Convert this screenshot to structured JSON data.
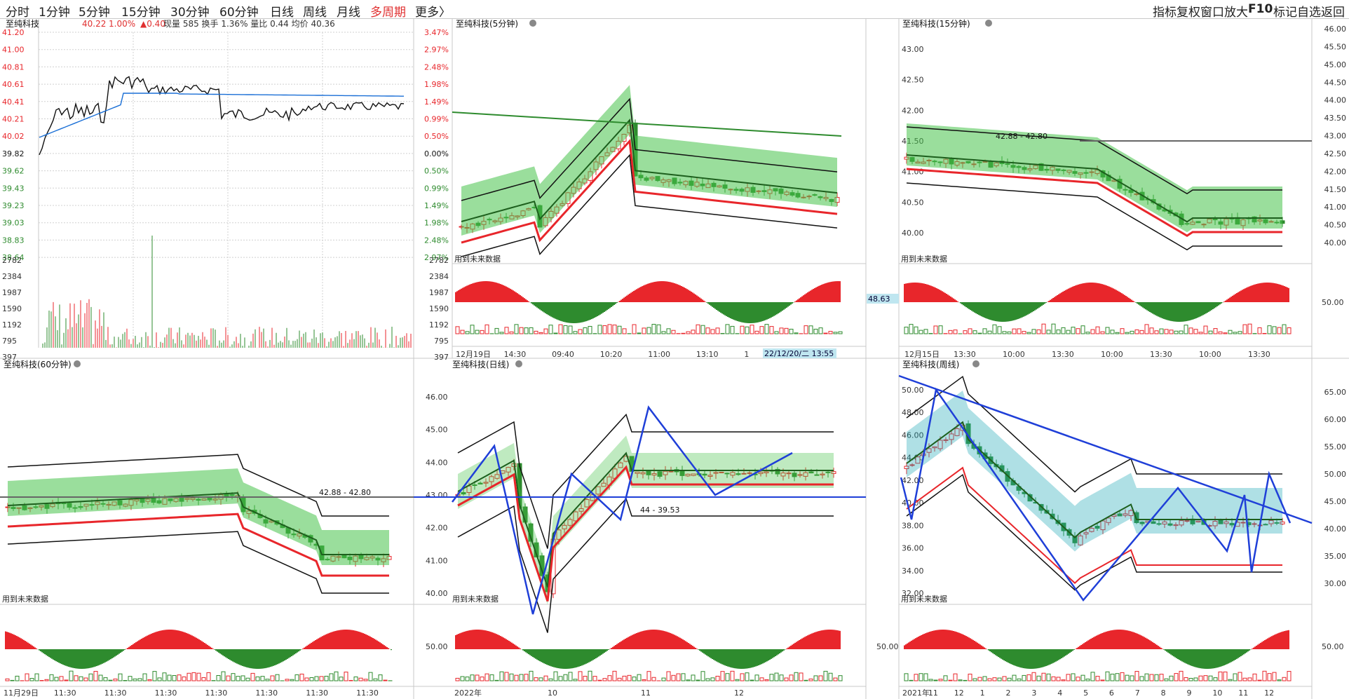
{
  "toolbar": {
    "tabs": [
      "分时",
      "1分钟",
      "5分钟",
      "15分钟",
      "30分钟",
      "60分钟",
      "日线",
      "周线",
      "月线",
      "多周期",
      "更多〉"
    ],
    "active_tab": "多周期",
    "tools": [
      "指标",
      "复权",
      "窗口",
      "放大",
      "F10",
      "标记",
      "自选",
      "返回"
    ]
  },
  "panels": {
    "intraday": {
      "title": "至纯科技",
      "price": "40.22",
      "pct": "1.00%",
      "change": "▲0.40",
      "info": "现量 585 换手 1.36% 量比 0.44 均价 40.36",
      "price_ticks": [
        "41.20",
        "41.00",
        "40.81",
        "40.61",
        "40.41",
        "40.21",
        "40.02",
        "39.82",
        "39.62",
        "39.43",
        "39.23",
        "39.03",
        "38.83",
        "38.64"
      ],
      "pct_ticks": [
        "3.47%",
        "2.97%",
        "2.48%",
        "1.98%",
        "1.49%",
        "0.99%",
        "0.50%",
        "0.00%",
        "0.50%",
        "0.99%",
        "1.49%",
        "1.98%",
        "2.48%",
        "2.97%"
      ],
      "vol_ticks": [
        "2782",
        "2384",
        "1987",
        "1590",
        "1192",
        "795",
        "397"
      ]
    },
    "p5m": {
      "title": "至纯科技(5分钟)",
      "future_label": "用到未来数据",
      "x_labels": [
        "12月19日",
        "14:30",
        "09:40",
        "10:20",
        "11:00",
        "13:10",
        "1"
      ],
      "cursor_time": "22/12/20/二 13:55"
    },
    "p15m": {
      "title": "至纯科技(15分钟)",
      "future_label": "用到未来数据",
      "left_ticks": [
        "43.00",
        "42.50",
        "42.00",
        "41.50",
        "41.00",
        "40.50",
        "40.00"
      ],
      "right_ticks": [
        "46.00",
        "45.50",
        "45.00",
        "44.50",
        "44.00",
        "43.50",
        "43.00",
        "42.50",
        "42.00",
        "41.50",
        "41.00",
        "40.50",
        "40.00"
      ],
      "hline_label": "42.88 - 42.80",
      "osc_value": "48.63",
      "osc_right_tick": "50.00",
      "x_labels": [
        "12月15日",
        "13:30",
        "10:00",
        "13:30",
        "10:00",
        "13:30",
        "10:00",
        "13:30"
      ]
    },
    "p60m": {
      "title": "至纯科技(60分钟)",
      "future_label": "用到未来数据",
      "hline_label": "42.88 - 42.80",
      "x_labels": [
        "11月29日",
        "11:30",
        "11:30",
        "11:30",
        "11:30",
        "11:30",
        "11:30",
        "11:30"
      ]
    },
    "pday": {
      "title": "至纯科技(日线)",
      "future_label": "用到未来数据",
      "left_ticks": [
        "46.00",
        "45.00",
        "44.00",
        "43.00",
        "42.00",
        "41.00",
        "40.00"
      ],
      "hline_label": "44 - 39.53",
      "osc_tick": "50.00",
      "x_labels": [
        "2022年",
        "10",
        "11",
        "12"
      ]
    },
    "pweek": {
      "title": "至纯科技(周线)",
      "future_label": "用到未来数据",
      "left_ticks": [
        "50.00",
        "48.00",
        "46.00",
        "44.00",
        "42.00",
        "40.00",
        "38.00",
        "36.00",
        "34.00",
        "32.00"
      ],
      "right_ticks": [
        "65.00",
        "60.00",
        "55.00",
        "50.00",
        "45.00",
        "40.00",
        "35.00",
        "30.00"
      ],
      "osc_tick": "50.00",
      "osc_right_tick": "50.00",
      "x_labels": [
        "2021年",
        "11",
        "12",
        "1",
        "2",
        "3",
        "4",
        "5",
        "6",
        "7",
        "8",
        "9",
        "10",
        "11",
        "12"
      ]
    }
  },
  "colors": {
    "up": "#e8262b",
    "down": "#2e8b2e",
    "accent": "#e03030",
    "grid": "#bdbdbd",
    "blue": "#1f3fd8",
    "avg": "#1a6fd6"
  }
}
